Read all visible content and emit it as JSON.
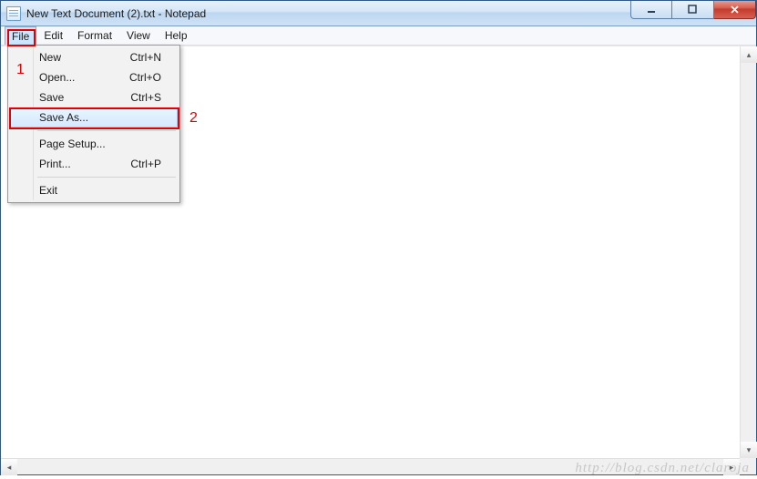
{
  "window": {
    "title": "New Text Document (2).txt - Notepad"
  },
  "menubar": {
    "items": [
      {
        "label": "File"
      },
      {
        "label": "Edit"
      },
      {
        "label": "Format"
      },
      {
        "label": "View"
      },
      {
        "label": "Help"
      }
    ]
  },
  "file_menu": {
    "items": [
      {
        "label": "New",
        "shortcut": "Ctrl+N"
      },
      {
        "label": "Open...",
        "shortcut": "Ctrl+O"
      },
      {
        "label": "Save",
        "shortcut": "Ctrl+S"
      },
      {
        "label": "Save As...",
        "shortcut": ""
      },
      {
        "label": "Page Setup...",
        "shortcut": ""
      },
      {
        "label": "Print...",
        "shortcut": "Ctrl+P"
      },
      {
        "label": "Exit",
        "shortcut": ""
      }
    ]
  },
  "annotations": {
    "one": "1",
    "two": "2"
  },
  "watermark": "http://blog.csdn.net/claroja",
  "icons": {
    "app": "notepad-icon",
    "minimize": "minimize-icon",
    "maximize": "maximize-icon",
    "close": "close-icon"
  }
}
